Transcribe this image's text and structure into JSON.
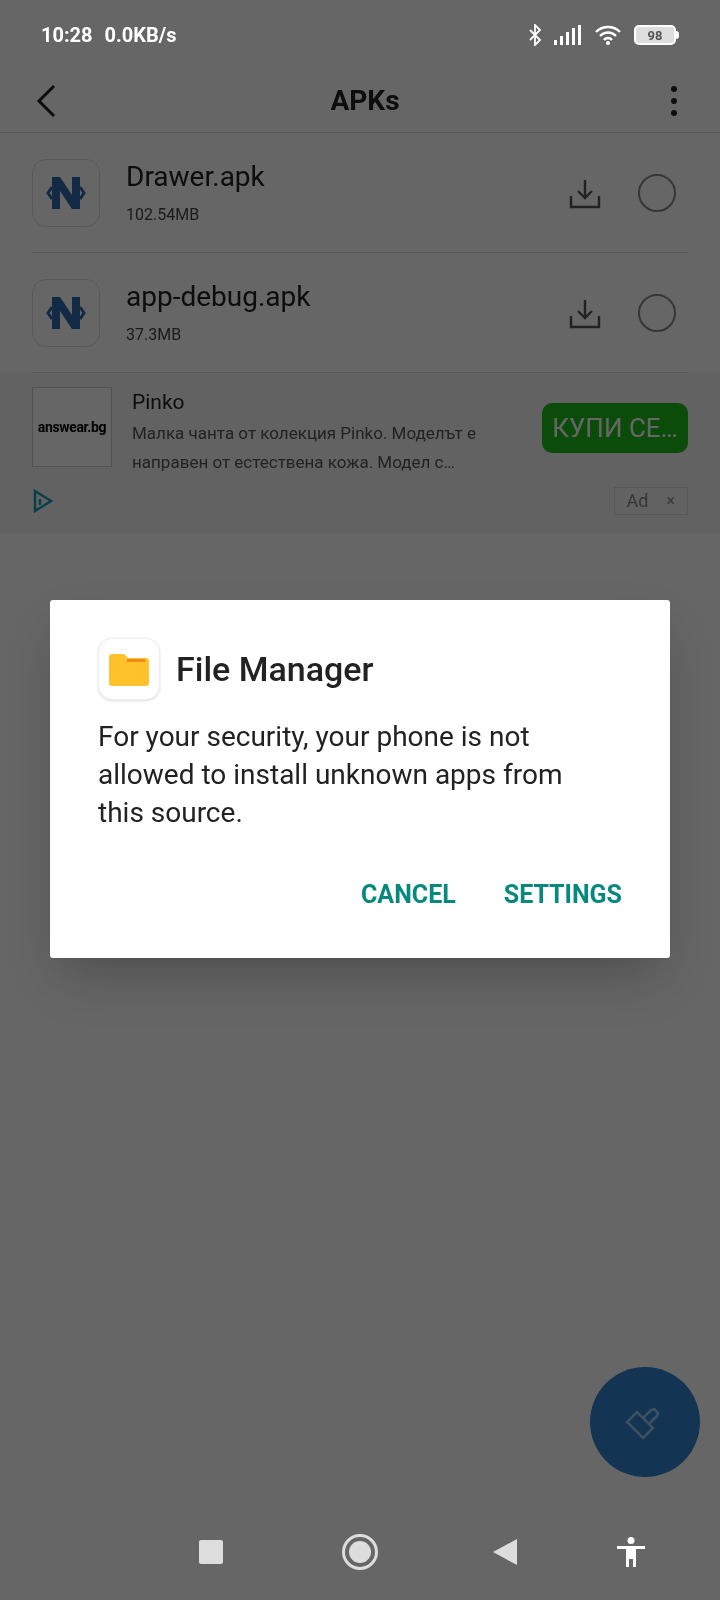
{
  "status_bar": {
    "time": "10:28",
    "net_speed": "0.0KB/s",
    "battery": "98"
  },
  "toolbar": {
    "title": "APKs"
  },
  "files": [
    {
      "name": "Drawer.apk",
      "size": "102.54MB",
      "selected": false
    },
    {
      "name": "app-debug.apk",
      "size": "37.3MB",
      "selected": false
    }
  ],
  "ad": {
    "logo": "answear.bg",
    "title": "Pinko",
    "body": "Малка чанта от колекция Pinko. Моделът е направен от естествена кожа. Модел с…",
    "button": "КУПИ СЕ…",
    "label": "Ad",
    "close": "×"
  },
  "dialog": {
    "app_name": "File Manager",
    "message": "For your security, your phone is not allowed to install unknown apps from this source.",
    "buttons": [
      "CANCEL",
      "SETTINGS"
    ]
  }
}
